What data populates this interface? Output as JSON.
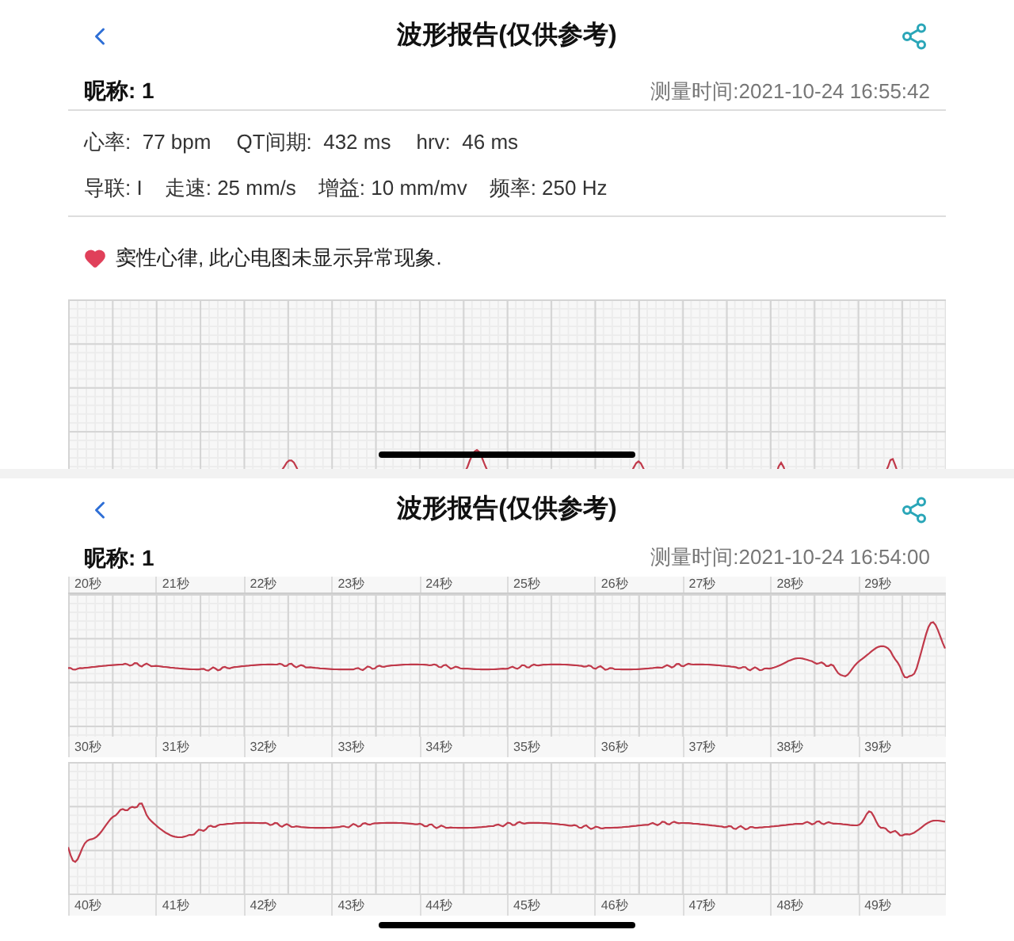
{
  "screens": [
    {
      "title": "波形报告(仅供参考)",
      "nickname": "昵称: 1",
      "measured_time": "测量时间:2021-10-24 16:55:42",
      "metrics": [
        "心率:  77 bpm",
        "QT间期:  432 ms",
        "hrv:  46 ms"
      ],
      "settings": [
        "导联: I",
        "走速: 25 mm/s",
        "增益: 10 mm/mv",
        "频率: 250 Hz"
      ],
      "diagnosis": "窦性心律, 此心电图未显示异常现象."
    },
    {
      "title": "波形报告(仅供参考)",
      "nickname": "昵称: 1",
      "measured_time": "测量时间:2021-10-24 16:54:00",
      "time_label_rows": [
        [
          "20秒",
          "21秒",
          "22秒",
          "23秒",
          "24秒",
          "25秒",
          "26秒",
          "27秒",
          "28秒",
          "29秒"
        ],
        [
          "30秒",
          "31秒",
          "32秒",
          "33秒",
          "34秒",
          "35秒",
          "36秒",
          "37秒",
          "38秒",
          "39秒"
        ],
        [
          "40秒",
          "41秒",
          "42秒",
          "43秒",
          "44秒",
          "45秒",
          "46秒",
          "47秒",
          "48秒",
          "49秒"
        ]
      ]
    }
  ]
}
